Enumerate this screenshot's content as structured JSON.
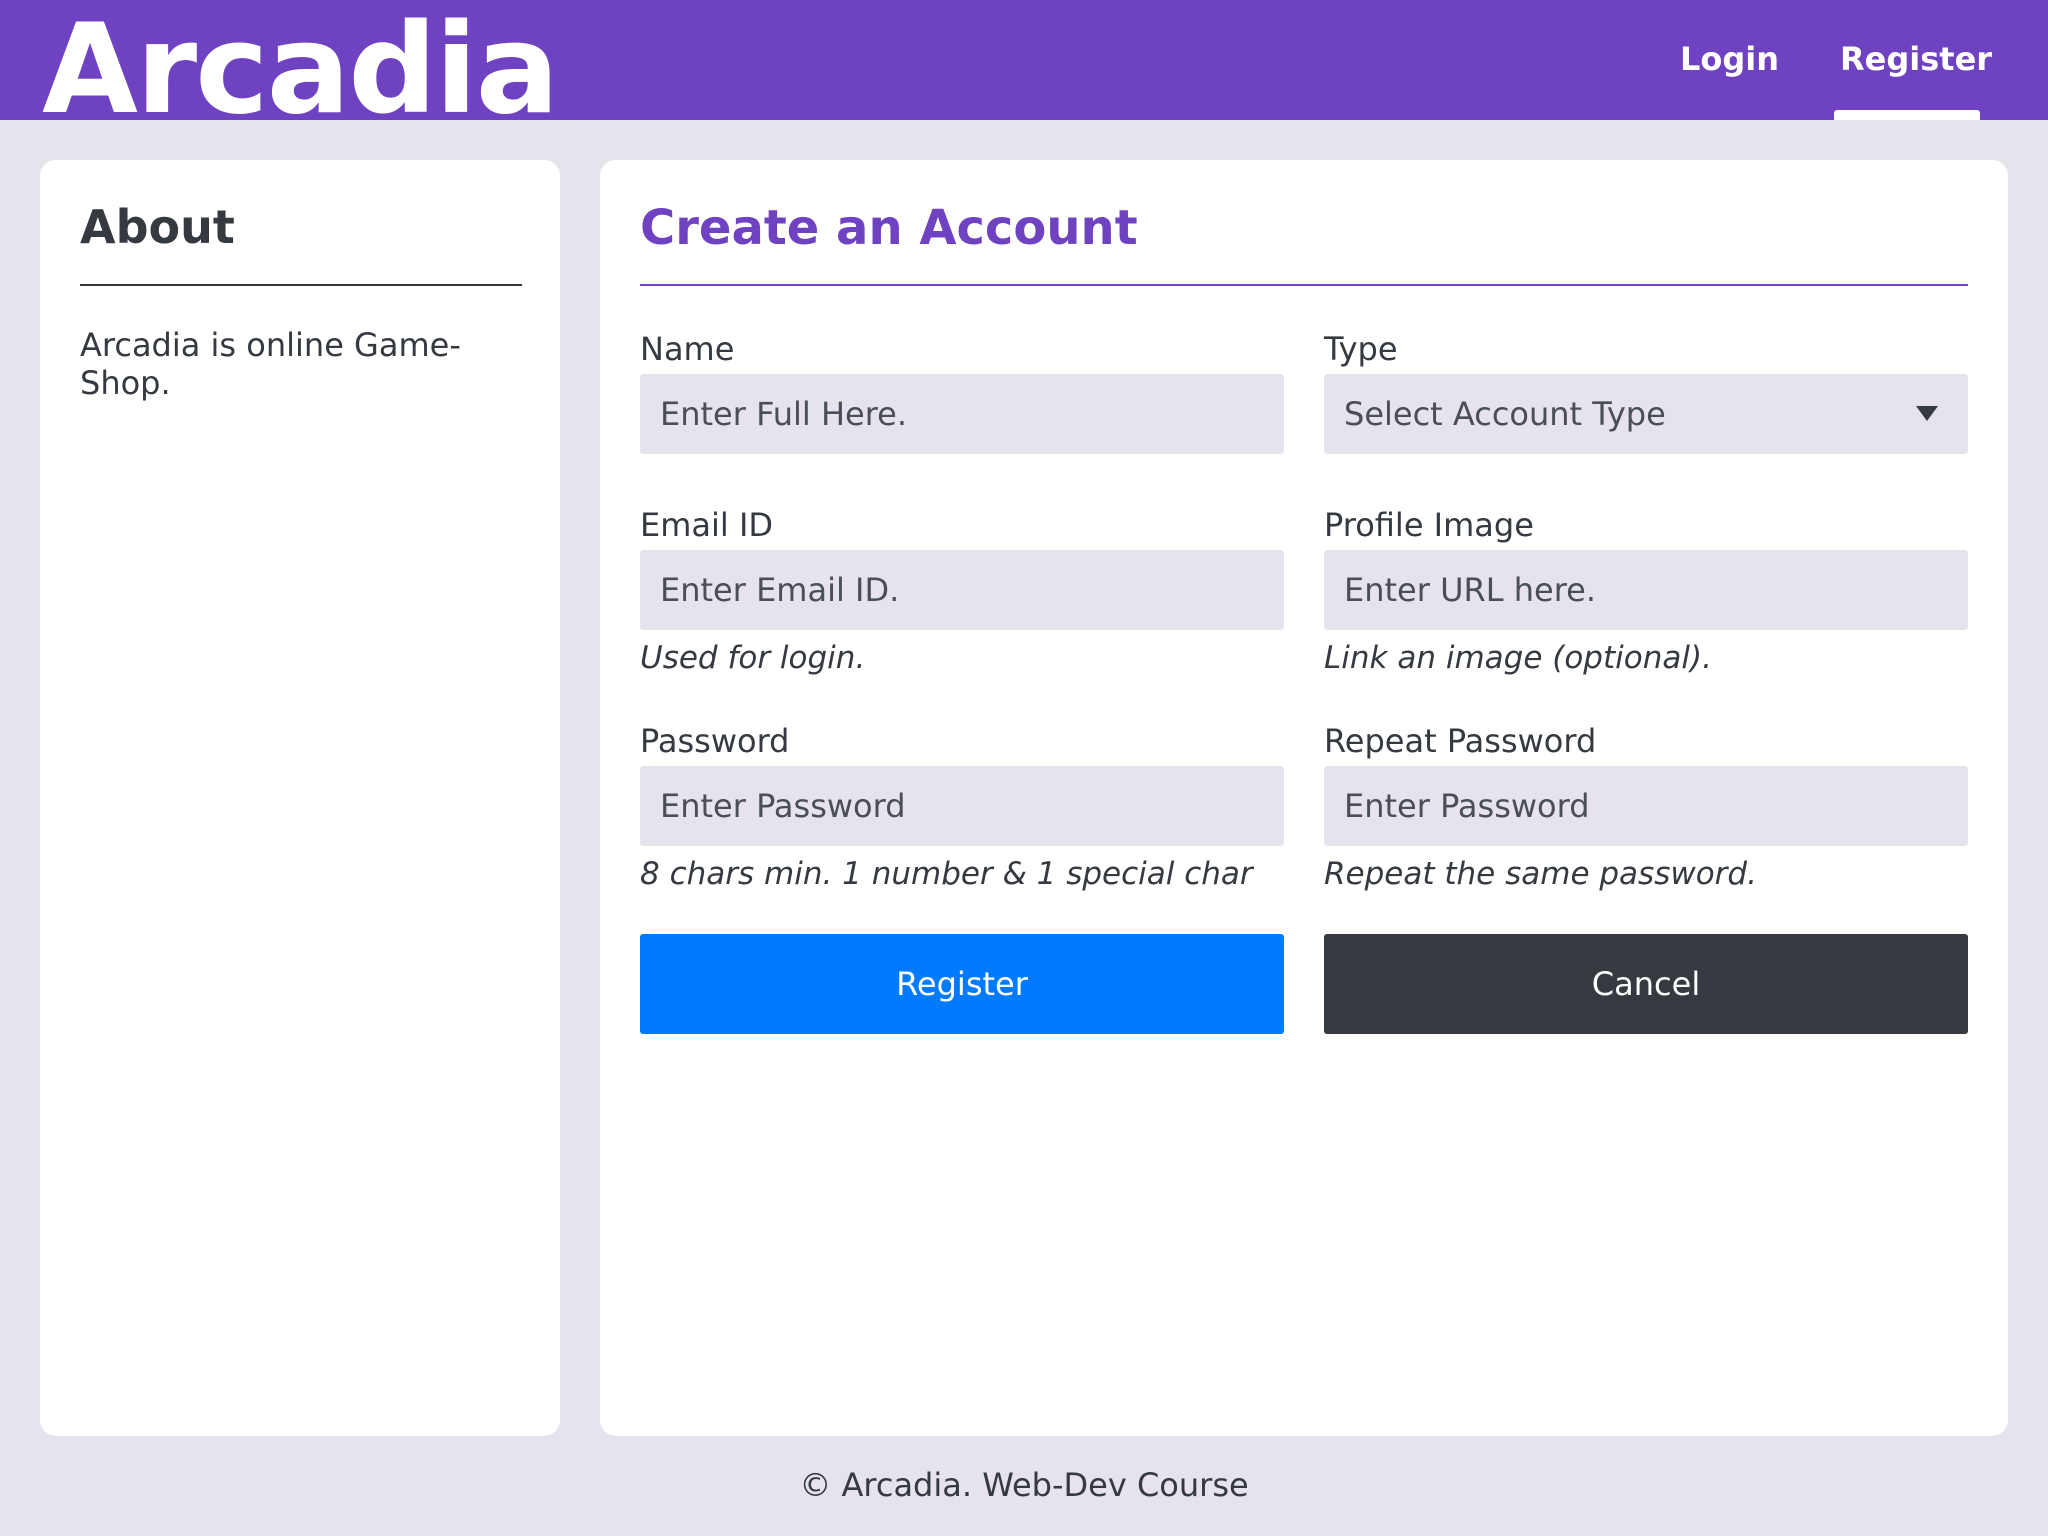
{
  "header": {
    "brand": "Arcadia",
    "nav": {
      "login": "Login",
      "register": "Register",
      "active": "register"
    }
  },
  "about": {
    "title": "About",
    "text": "Arcadia is online Game-Shop."
  },
  "form": {
    "title": "Create an Account",
    "name": {
      "label": "Name",
      "placeholder": "Enter Full Here."
    },
    "type": {
      "label": "Type",
      "selected": "Select Account Type"
    },
    "email": {
      "label": "Email ID",
      "placeholder": "Enter Email ID.",
      "help": "Used for login."
    },
    "profile_image": {
      "label": "Profile Image",
      "placeholder": "Enter URL here.",
      "help": "Link an image (optional)."
    },
    "password": {
      "label": "Password",
      "placeholder": "Enter Password",
      "help": "8 chars min. 1 number & 1 special char"
    },
    "repeat_password": {
      "label": "Repeat Password",
      "placeholder": "Enter Password",
      "help": "Repeat the same password."
    },
    "register_label": "Register",
    "cancel_label": "Cancel"
  },
  "footer": {
    "text": "© Arcadia. Web-Dev Course"
  },
  "colors": {
    "brand_purple": "#6f42c1",
    "background": "#e6e3ed",
    "primary_blue": "#007bff",
    "dark": "#343a40"
  }
}
